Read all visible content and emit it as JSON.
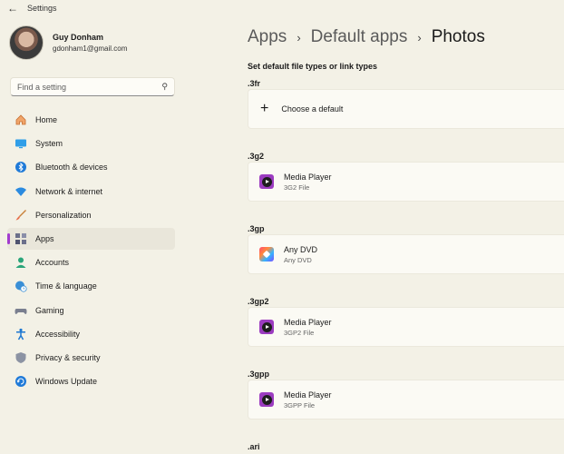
{
  "window": {
    "title": "Settings"
  },
  "profile": {
    "name": "Guy Donham",
    "email": "gdonham1@gmail.com"
  },
  "search": {
    "placeholder": "Find a setting"
  },
  "nav": {
    "items": [
      {
        "label": "Home",
        "icon": "home-icon"
      },
      {
        "label": "System",
        "icon": "monitor-icon"
      },
      {
        "label": "Bluetooth & devices",
        "icon": "bluetooth-icon"
      },
      {
        "label": "Network & internet",
        "icon": "wifi-icon"
      },
      {
        "label": "Personalization",
        "icon": "brush-icon"
      },
      {
        "label": "Apps",
        "icon": "apps-icon",
        "active": true
      },
      {
        "label": "Accounts",
        "icon": "person-icon"
      },
      {
        "label": "Time & language",
        "icon": "globe-clock-icon"
      },
      {
        "label": "Gaming",
        "icon": "gamepad-icon"
      },
      {
        "label": "Accessibility",
        "icon": "accessibility-icon"
      },
      {
        "label": "Privacy & security",
        "icon": "shield-icon"
      },
      {
        "label": "Windows Update",
        "icon": "update-icon"
      }
    ]
  },
  "breadcrumb": {
    "items": [
      "Apps",
      "Default apps",
      "Photos"
    ],
    "separator": "›"
  },
  "main": {
    "section_title": "Set default file types or link types",
    "file_types": [
      {
        "ext": ".3fr",
        "app": "Choose a default",
        "sub": "",
        "icon": "plus-icon"
      },
      {
        "ext": ".3g2",
        "app": "Media Player",
        "sub": "3G2 File",
        "icon": "media-player-icon"
      },
      {
        "ext": ".3gp",
        "app": "Any DVD",
        "sub": "Any DVD",
        "icon": "anydvd-icon"
      },
      {
        "ext": ".3gp2",
        "app": "Media Player",
        "sub": "3GP2 File",
        "icon": "media-player-icon"
      },
      {
        "ext": ".3gpp",
        "app": "Media Player",
        "sub": "3GPP File",
        "icon": "media-player-icon"
      },
      {
        "ext": ".ari"
      }
    ]
  },
  "colors": {
    "accent": "#a23ccf",
    "background": "#f3f1e6",
    "card": "#fbfaf4"
  }
}
